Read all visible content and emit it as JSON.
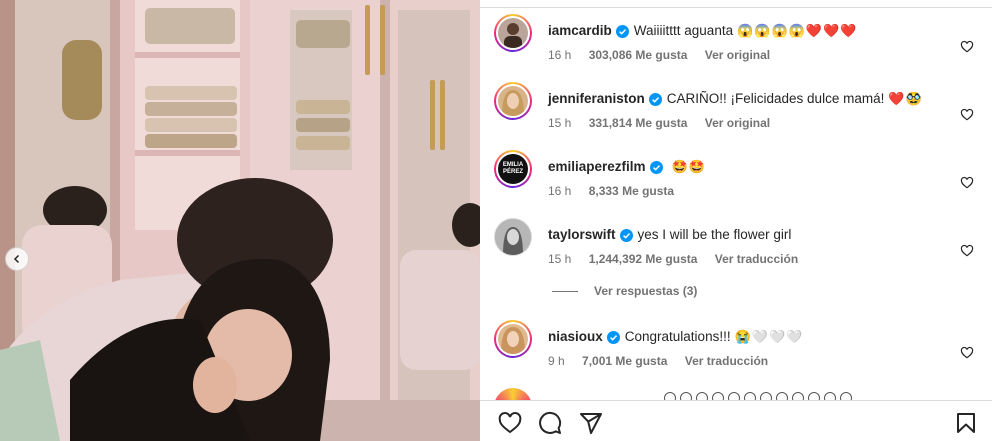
{
  "post": {
    "carousel_prev_icon": "chevron-left-icon"
  },
  "comments": [
    {
      "username": "iamcardib",
      "text": "Waiiiitttt aguanta",
      "emojis": "😱😱😱😱❤️❤️❤️",
      "time": "16 h",
      "likes": "303,086 Me gusta",
      "action": "Ver original",
      "avatar_color": "#b9a59a"
    },
    {
      "username": "jenniferaniston",
      "text": "CARIÑO!! ¡Felicidades dulce mamá!",
      "emojis": "❤️🥸",
      "time": "15 h",
      "likes": "331,814 Me gusta",
      "action": "Ver original",
      "avatar_color": "#d9b48a"
    },
    {
      "username": "emiliaperezfilm",
      "text": "",
      "emojis": "🤩🤩",
      "time": "16 h",
      "likes": "8,333 Me gusta",
      "action": "",
      "avatar_label": "EMILIA PÉREZ",
      "avatar_color": "#111111"
    },
    {
      "username": "taylorswift",
      "text": "yes I will be the flower girl",
      "emojis": "",
      "time": "15 h",
      "likes": "1,244,392 Me gusta",
      "action": "Ver traducción",
      "avatar_color": "#8a8a8a"
    },
    {
      "username": "niasioux",
      "text": "Congratulations!!!",
      "emojis": "😭🤍🤍🤍",
      "time": "9 h",
      "likes": "7,001 Me gusta",
      "action": "Ver traducción",
      "avatar_color": "#e0b98e"
    }
  ],
  "replies": {
    "label": "Ver respuestas (3)"
  },
  "colors": {
    "verified": "#0095f6",
    "meta_text": "#737373",
    "border": "#dbdbdb"
  },
  "actions": {
    "like_icon": "heart-icon",
    "comment_icon": "comment-icon",
    "share_icon": "send-icon",
    "save_icon": "bookmark-icon"
  }
}
